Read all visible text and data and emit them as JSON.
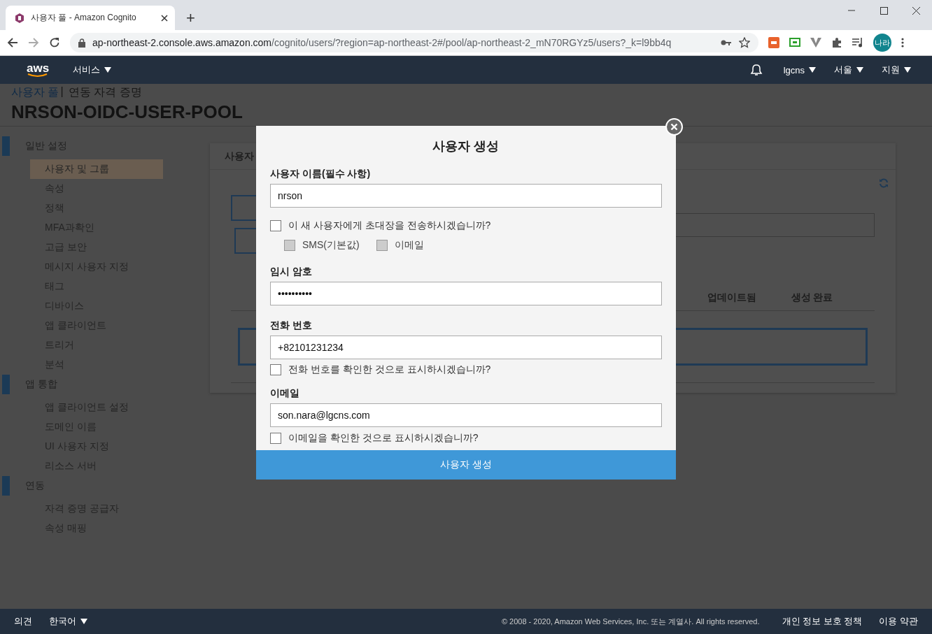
{
  "browser": {
    "tab_title": "사용자 풀 - Amazon Cognito",
    "new_tab": "+",
    "url_host": "ap-northeast-2.console.aws.amazon.com",
    "url_path": "/cognito/users/?region=ap-northeast-2#/pool/ap-northeast-2_mN70RGYz5/users?_k=l9bb4q",
    "profile": "나라"
  },
  "aws_header": {
    "logo": "aws",
    "services": "서비스",
    "account": "lgcns",
    "region": "서울",
    "support": "지원"
  },
  "page": {
    "breadcrumb": [
      {
        "label": "사용자 풀",
        "kind": "link"
      },
      {
        "label": "|",
        "kind": "separator"
      },
      {
        "label": "연동 자격 증명",
        "kind": "text"
      }
    ],
    "title": "NRSON-OIDC-USER-POOL"
  },
  "sidebar": [
    {
      "title": "일반 설정",
      "items": [
        {
          "label": "사용자 및 그룹",
          "selected": true
        },
        {
          "label": "속성",
          "selected": false
        },
        {
          "label": "정책",
          "selected": false
        },
        {
          "label": "MFA과확인",
          "selected": false
        },
        {
          "label": "고급 보안",
          "selected": false
        },
        {
          "label": "메시지 사용자 지정",
          "selected": false
        },
        {
          "label": "태그",
          "selected": false
        },
        {
          "label": "디바이스",
          "selected": false
        },
        {
          "label": "앱 클라이언트",
          "selected": false
        },
        {
          "label": "트리거",
          "selected": false
        },
        {
          "label": "분석",
          "selected": false
        }
      ]
    },
    {
      "title": "앱 통합",
      "items": [
        {
          "label": "앱 클라이언트 설정",
          "selected": false
        },
        {
          "label": "도메인 이름",
          "selected": false
        },
        {
          "label": "UI 사용자 지정",
          "selected": false
        },
        {
          "label": "리소스 서버",
          "selected": false
        }
      ]
    },
    {
      "title": "연동",
      "items": [
        {
          "label": "자격 증명 공급자",
          "selected": false
        },
        {
          "label": "속성 매핑",
          "selected": false
        }
      ]
    }
  ],
  "panel": {
    "tab": "사용자",
    "columns": [
      "업데이트됨",
      "생성 완료"
    ]
  },
  "modal": {
    "title": "사용자 생성",
    "fields": [
      {
        "kind": "text",
        "label": "사용자 이름(필수 사항)",
        "value": "nrson"
      },
      {
        "kind": "checkbox",
        "label": "이 새 사용자에게 초대장을 전송하시겠습니까?",
        "checked": false
      },
      {
        "kind": "options",
        "options": [
          {
            "label": "SMS(기본값)",
            "checked": false,
            "disabled": true
          },
          {
            "label": "이메일",
            "checked": false,
            "disabled": true
          }
        ]
      },
      {
        "kind": "text",
        "label": "임시 암호",
        "value": "••••••••••"
      },
      {
        "kind": "text",
        "label": "전화 번호",
        "value": "+82101231234"
      },
      {
        "kind": "checkbox",
        "label": "전화 번호를 확인한 것으로 표시하시겠습니까?",
        "checked": false
      },
      {
        "kind": "text",
        "label": "이메일",
        "value": "son.nara@lgcns.com"
      },
      {
        "kind": "checkbox",
        "label": "이메일을 확인한 것으로 표시하시겠습니까?",
        "checked": false
      }
    ],
    "submit": "사용자 생성"
  },
  "footer": {
    "feedback": "의견",
    "language": "한국어",
    "copyright": "© 2008 - 2020, Amazon Web Services, Inc. 또는 계열사. All rights reserved.",
    "privacy": "개인 정보 보호 정책",
    "terms": "이용 약관"
  }
}
